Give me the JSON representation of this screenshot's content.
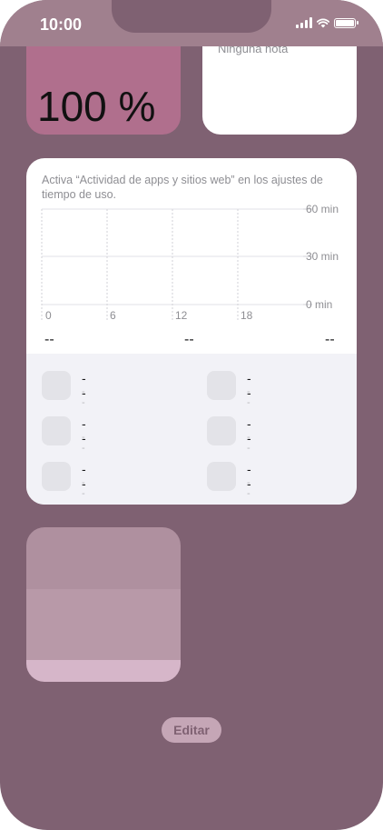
{
  "status_bar": {
    "time": "10:00"
  },
  "battery_widget": {
    "percent": "100 %"
  },
  "notes_widget": {
    "text": "Ninguna nota"
  },
  "screen_time_widget": {
    "message": "Activa “Actividad de apps y sitios web” en los ajustes de tiempo de uso.",
    "chart_data": {
      "type": "bar",
      "x_ticks": [
        "0",
        "6",
        "12",
        "18"
      ],
      "y_ticks": [
        "60 min",
        "30 min",
        "0 min"
      ],
      "ylim": [
        0,
        60
      ],
      "series": []
    },
    "usage_values": [
      "--",
      "--",
      "--"
    ],
    "apps": [
      {
        "name": "--",
        "time": "--"
      },
      {
        "name": "--",
        "time": "--"
      },
      {
        "name": "--",
        "time": "--"
      },
      {
        "name": "--",
        "time": "--"
      },
      {
        "name": "--",
        "time": "--"
      },
      {
        "name": "--",
        "time": "--"
      }
    ]
  },
  "edit_button": {
    "label": "Editar"
  },
  "colors": {
    "background": "#7f6172",
    "status_bar": "#a0808e",
    "battery_widget": "#b06f8d",
    "battery_ring": "#55b66c",
    "edit_button": "#c5a6b6"
  }
}
